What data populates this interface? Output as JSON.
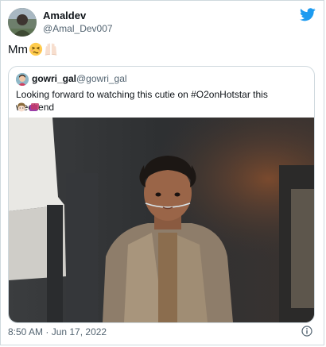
{
  "tweet": {
    "author_name": "Amaldev",
    "author_handle": "@Amal_Dev007",
    "text": "Mm",
    "emojis": [
      "persevering-face-emoji",
      "raised-hands-emoji"
    ],
    "timestamp": "8:50 AM · Jun 17, 2022"
  },
  "quoted_tweet": {
    "author_name": "gowri_gal",
    "author_handle": "@gowri_gal",
    "text": "Looking forward to watching this cutie on #O2onHotstar this weekend",
    "emojis": [
      "woman-face-emoji",
      "purple-bag-emoji"
    ],
    "media": "photo"
  },
  "icons": {
    "brand": "twitter-bird-icon",
    "info": "info-icon"
  },
  "colors": {
    "brand": "#1d9bf0",
    "secondary_text": "#536471",
    "border": "#cfd9de"
  }
}
